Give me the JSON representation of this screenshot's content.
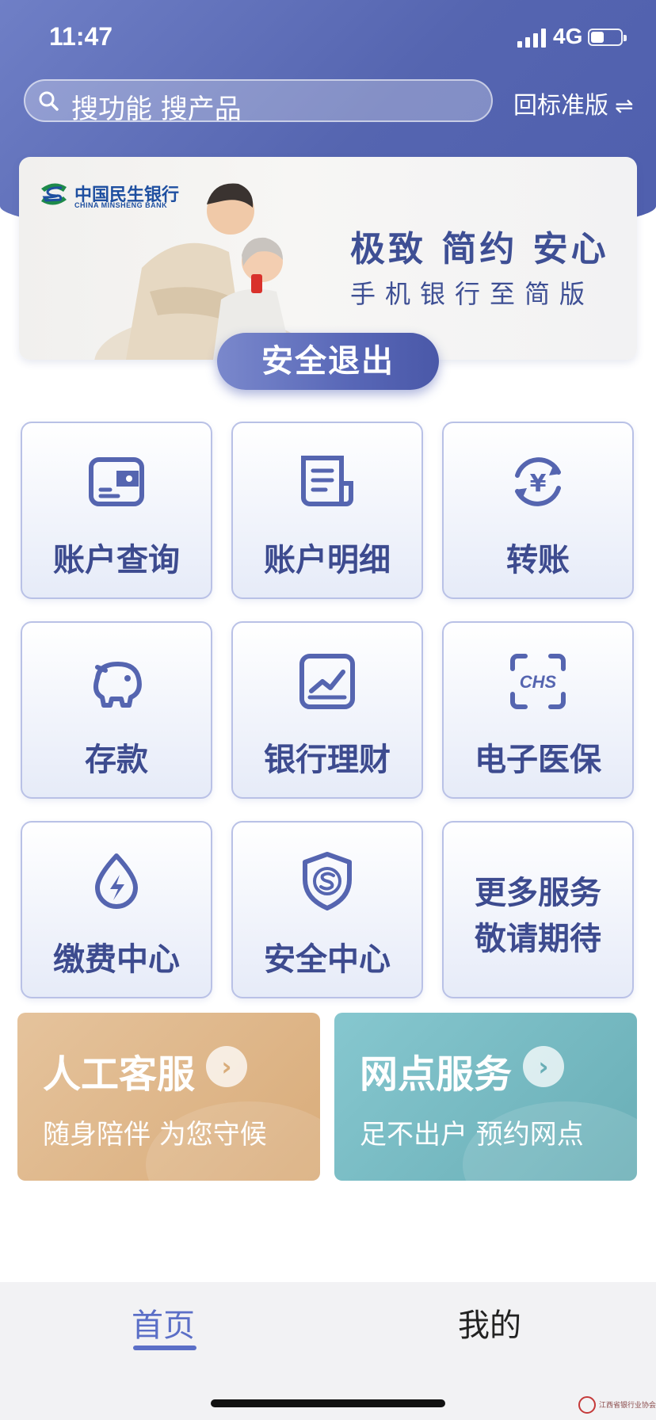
{
  "status_bar": {
    "time": "11:47",
    "network": "4G",
    "battery_level": 0.45
  },
  "search": {
    "placeholder": "搜功能 搜产品"
  },
  "header": {
    "switch_label": "回标准版",
    "switch_icon": "swap-arrows-icon",
    "switch_glyph": "⇌"
  },
  "banner": {
    "bank_name_zh": "中国民生银行",
    "bank_name_en": "CHINA MINSHENG BANK",
    "slogan": "极致 简约 安心",
    "subtitle": "手机银行至简版"
  },
  "logout": {
    "label": "安全退出"
  },
  "services": [
    {
      "label": "账户查询",
      "icon": "wallet-card-icon"
    },
    {
      "label": "账户明细",
      "icon": "document-list-icon"
    },
    {
      "label": "转账",
      "icon": "yuan-exchange-icon"
    },
    {
      "label": "存款",
      "icon": "piggy-bank-icon"
    },
    {
      "label": "银行理财",
      "icon": "chart-trend-icon"
    },
    {
      "label": "电子医保",
      "icon": "chs-scan-icon"
    },
    {
      "label": "缴费中心",
      "icon": "water-drop-lightning-icon"
    },
    {
      "label": "安全中心",
      "icon": "shield-s-icon"
    },
    {
      "label": "更多服务\n敬请期待",
      "line1": "更多服务",
      "line2": "敬请期待"
    }
  ],
  "cards": {
    "customer_service": {
      "title": "人工客服",
      "subtitle": "随身陪伴 为您守候"
    },
    "branch_service": {
      "title": "网点服务",
      "subtitle": "足不出户 预约网点"
    }
  },
  "icons": {
    "chs_text": "CHS",
    "yuan": "¥"
  },
  "tabs": {
    "home": "首页",
    "mine": "我的",
    "active": "home"
  },
  "watermark": {
    "text": "江西省银行业协会"
  },
  "colors": {
    "primary": "#5565b0",
    "text": "#3d4b8f",
    "cs_card": "#d9ac7a",
    "branch_card": "#69aeb6",
    "tab_active": "#5b6fc7"
  }
}
